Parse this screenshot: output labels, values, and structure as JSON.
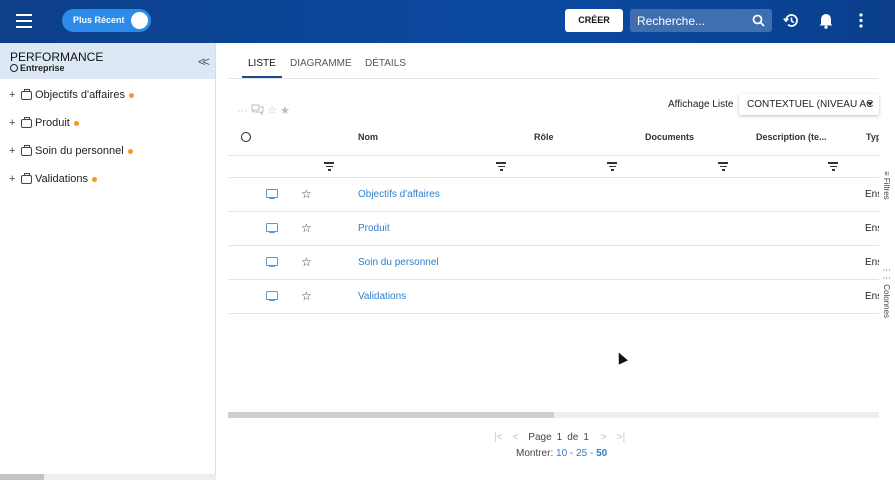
{
  "topbar": {
    "toggle_label": "Plus Récent",
    "create_label": "CRÉER",
    "search_placeholder": "Recherche..."
  },
  "sidebar": {
    "title": "PERFORMANCE",
    "subtitle": "Entreprise",
    "items": [
      {
        "label": "Objectifs d'affaires"
      },
      {
        "label": "Produit"
      },
      {
        "label": "Soin du personnel"
      },
      {
        "label": "Validations"
      }
    ]
  },
  "tabs": [
    {
      "label": "LISTE",
      "active": true
    },
    {
      "label": "DIAGRAMME",
      "active": false
    },
    {
      "label": "DÉTAILS",
      "active": false
    }
  ],
  "toolbar": {
    "view_label": "Affichage Liste",
    "view_value": "CONTEXTUEL (NIVEAU AC"
  },
  "grid": {
    "columns": [
      "Nom",
      "Rôle",
      "Documents",
      "Description (te...",
      "Typ"
    ],
    "rows": [
      {
        "name": "Objectifs d'affaires",
        "type": "Ens"
      },
      {
        "name": "Produit",
        "type": "Ens"
      },
      {
        "name": "Soin du personnel",
        "type": "Ens"
      },
      {
        "name": "Validations",
        "type": "Ens"
      }
    ]
  },
  "pagination": {
    "page_label": "Page",
    "page": "1",
    "of_label": "de",
    "total": "1",
    "show_label": "Montrer:",
    "sizes": [
      "10",
      "25",
      "50"
    ],
    "selected_size": "50"
  },
  "side_panels": {
    "filters": "Filtres",
    "columns": "Colonnes"
  },
  "colors": {
    "topbar": "#0b4aa2",
    "accent": "#2a8be8",
    "link": "#2f7fc9",
    "status_dot": "#f39a21"
  }
}
